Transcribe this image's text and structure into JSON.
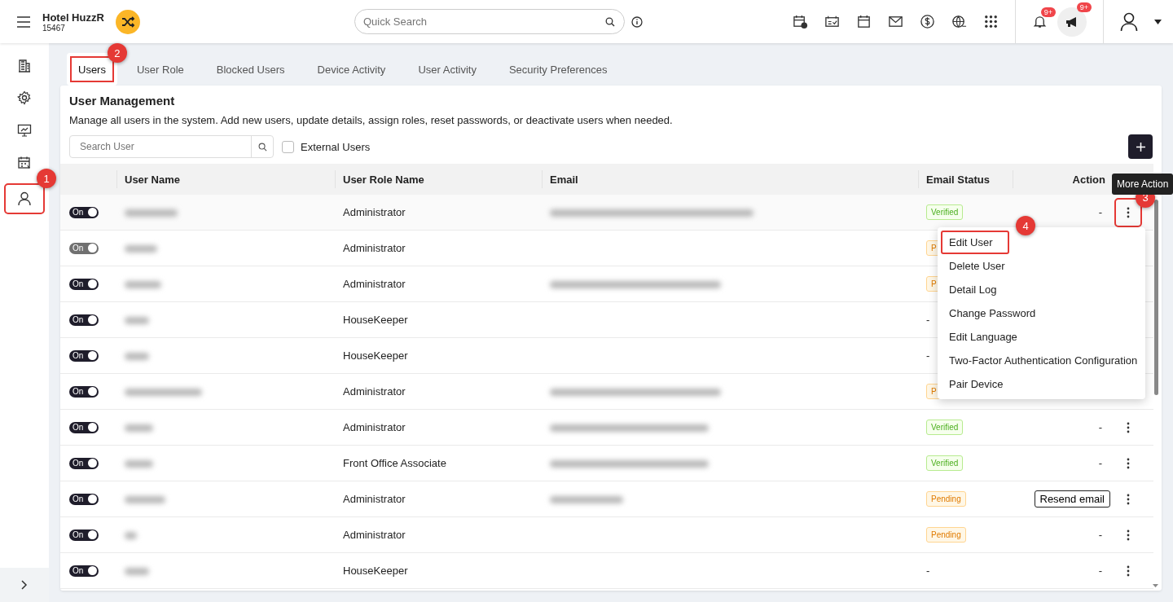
{
  "header": {
    "hotel_name": "Hotel HuzzR",
    "hotel_code": "15467",
    "search": {
      "placeholder": "Quick Search"
    },
    "alerts": [
      {
        "kind": "bell",
        "badge": "9+"
      },
      {
        "kind": "megaphone",
        "badge": "9+"
      }
    ]
  },
  "sidebar": {
    "items": [
      {
        "kind": "building"
      },
      {
        "kind": "gear"
      },
      {
        "kind": "monitor"
      },
      {
        "kind": "calendar"
      },
      {
        "kind": "user",
        "callout": "1"
      }
    ]
  },
  "tabs": [
    {
      "label": "Users",
      "selected": true,
      "callout": "2"
    },
    {
      "label": "User Role",
      "selected": false
    },
    {
      "label": "Blocked Users",
      "selected": false
    },
    {
      "label": "Device Activity",
      "selected": false
    },
    {
      "label": "User Activity",
      "selected": false
    },
    {
      "label": "Security Preferences",
      "selected": false
    }
  ],
  "panel": {
    "title": "User Management",
    "description": "Manage all users in the system. Add new users, update details, assign roles, reset passwords, or deactivate users when needed.",
    "search": {
      "placeholder": "Search User"
    },
    "external_users": {
      "label": "External Users",
      "checked": false
    }
  },
  "table": {
    "columns": [
      "User Name",
      "User Role Name",
      "Email",
      "Email Status",
      "Action"
    ],
    "rows": [
      {
        "toggle": "On",
        "disabled": false,
        "name_hidden": true,
        "role": "Administrator",
        "email_hidden": true,
        "status": {
          "kind": "verified",
          "label": "Verified"
        },
        "action": {
          "kind": "text",
          "label": "-"
        },
        "menu_open": true,
        "tooltip": "More Action",
        "menu_callout": "3"
      },
      {
        "toggle": "On",
        "disabled": true,
        "name_hidden": true,
        "role": "Administrator",
        "email_hidden": false,
        "status": {
          "kind": "pending",
          "label": "P"
        },
        "menu_open": false
      },
      {
        "toggle": "On",
        "disabled": false,
        "name_hidden": true,
        "role": "Administrator",
        "email_hidden": true,
        "status": {
          "kind": "pending",
          "label": "P"
        },
        "menu_open": false
      },
      {
        "toggle": "On",
        "disabled": false,
        "name_hidden": true,
        "role": "HouseKeeper",
        "email_hidden": false,
        "status": {
          "kind": "none",
          "label": "-"
        },
        "menu_open": false
      },
      {
        "toggle": "On",
        "disabled": false,
        "name_hidden": true,
        "role": "HouseKeeper",
        "email_hidden": false,
        "status": {
          "kind": "none",
          "label": "-"
        },
        "menu_open": false
      },
      {
        "toggle": "On",
        "disabled": false,
        "name_hidden": true,
        "role": "Administrator",
        "email_hidden": true,
        "status": {
          "kind": "pending",
          "label": "P"
        },
        "menu_open": false
      },
      {
        "toggle": "On",
        "disabled": false,
        "name_hidden": true,
        "role": "Administrator",
        "email_hidden": true,
        "status": {
          "kind": "verified",
          "label": "Verified"
        },
        "action": {
          "kind": "text",
          "label": "-"
        },
        "menu_open": false
      },
      {
        "toggle": "On",
        "disabled": false,
        "name_hidden": true,
        "role": "Front Office Associate",
        "email_hidden": true,
        "status": {
          "kind": "verified",
          "label": "Verified"
        },
        "action": {
          "kind": "text",
          "label": "-"
        },
        "menu_open": false
      },
      {
        "toggle": "On",
        "disabled": false,
        "name_hidden": true,
        "role": "Administrator",
        "email_hidden": true,
        "status": {
          "kind": "pending",
          "label": "Pending"
        },
        "action": {
          "kind": "button",
          "label": "Resend email"
        },
        "menu_open": false
      },
      {
        "toggle": "On",
        "disabled": false,
        "name_hidden": true,
        "role": "Administrator",
        "email_hidden": false,
        "status": {
          "kind": "pending",
          "label": "Pending"
        },
        "action": {
          "kind": "text",
          "label": "-"
        },
        "menu_open": false
      },
      {
        "toggle": "On",
        "disabled": false,
        "name_hidden": true,
        "role": "HouseKeeper",
        "email_hidden": false,
        "status": {
          "kind": "none",
          "label": "-"
        },
        "action": {
          "kind": "text",
          "label": "-"
        },
        "menu_open": false
      }
    ]
  },
  "row_menu": {
    "items": [
      {
        "label": "Edit User",
        "callout": "4"
      },
      {
        "label": "Delete User"
      },
      {
        "label": "Detail Log"
      },
      {
        "label": "Change Password"
      },
      {
        "label": "Edit Language"
      },
      {
        "label": "Two-Factor Authentication Configuration"
      },
      {
        "label": "Pair Device"
      }
    ]
  }
}
